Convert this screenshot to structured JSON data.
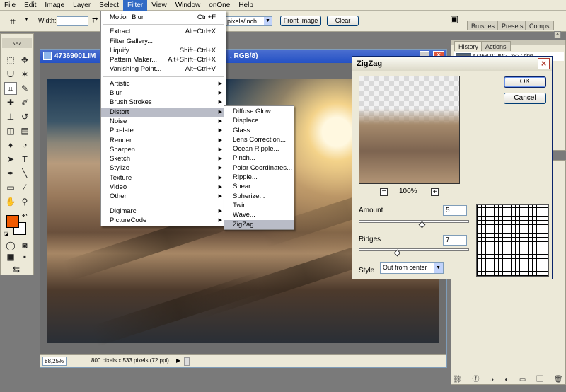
{
  "menubar": {
    "items": [
      "File",
      "Edit",
      "Image",
      "Layer",
      "Select",
      "Filter",
      "View",
      "Window",
      "onOne",
      "Help"
    ],
    "active": "Filter"
  },
  "options": {
    "width_label": "Width:",
    "resolution_unit": "pixels/inch",
    "front_image": "Front Image",
    "clear": "Clear"
  },
  "palette_tabs": {
    "brushes": "Brushes",
    "presets": "Presets",
    "comps": "Comps",
    "history": "History",
    "actions": "Actions",
    "history_item": "47369001.IMG_2927.dng"
  },
  "document": {
    "title": "47369001.IM",
    "title_suffix": ", RGB/8)",
    "zoom": "88,25%",
    "status": "800 pixels x 533 pixels (72 ppi)"
  },
  "filter_menu": {
    "last_filter": {
      "label": "Motion Blur",
      "shortcut": "Ctrl+F"
    },
    "group1": [
      {
        "label": "Extract...",
        "shortcut": "Alt+Ctrl+X"
      },
      {
        "label": "Filter Gallery...",
        "shortcut": ""
      },
      {
        "label": "Liquify...",
        "shortcut": "Shift+Ctrl+X"
      },
      {
        "label": "Pattern Maker...",
        "shortcut": "Alt+Shift+Ctrl+X"
      },
      {
        "label": "Vanishing Point...",
        "shortcut": "Alt+Ctrl+V"
      }
    ],
    "group2": [
      "Artistic",
      "Blur",
      "Brush Strokes",
      "Distort",
      "Noise",
      "Pixelate",
      "Render",
      "Sharpen",
      "Sketch",
      "Stylize",
      "Texture",
      "Video",
      "Other"
    ],
    "group3": [
      "Digimarc",
      "PictureCode"
    ],
    "highlighted": "Distort"
  },
  "distort_menu": {
    "items": [
      "Diffuse Glow...",
      "Displace...",
      "Glass...",
      "Lens Correction...",
      "Ocean Ripple...",
      "Pinch...",
      "Polar Coordinates...",
      "Ripple...",
      "Shear...",
      "Spherize...",
      "Twirl...",
      "Wave...",
      "ZigZag..."
    ],
    "highlighted": "ZigZag..."
  },
  "zigzag": {
    "title": "ZigZag",
    "ok": "OK",
    "cancel": "Cancel",
    "zoom": "100%",
    "zoom_out": "−",
    "zoom_in": "+",
    "amount_label": "Amount",
    "amount": "5",
    "amount_fraction": 0.58,
    "ridges_label": "Ridges",
    "ridges": "7",
    "ridges_fraction": 0.35,
    "style_label": "Style",
    "style": "Out from center"
  },
  "colors": {
    "foreground": "#f05a00",
    "background": "#ffffff",
    "accent": "#316ac5"
  }
}
